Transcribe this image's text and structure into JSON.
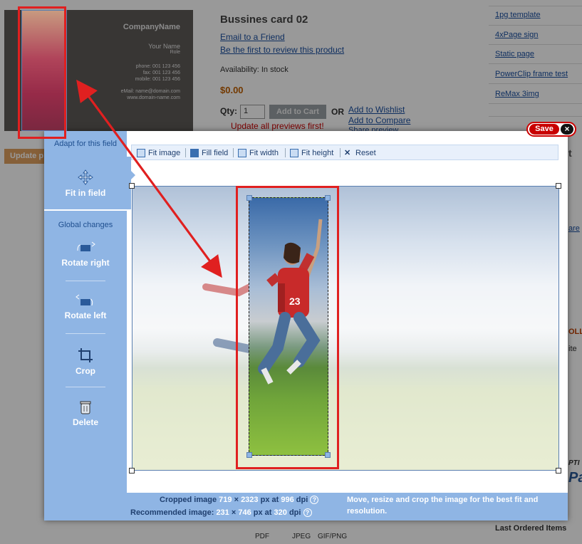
{
  "product": {
    "title": "Bussines card 02",
    "email_friend": "Email to a Friend",
    "review": "Be the first to review this product",
    "availability": "Availability: In stock",
    "price": "$0.00",
    "qty_label": "Qty:",
    "qty_value": "1",
    "add_to_cart": "Add to Cart",
    "or": "OR",
    "wishlist": "Add to Wishlist",
    "compare": "Add to Compare",
    "share": "Share preview",
    "update_warning": "Update all previews first!",
    "update_button": "Update p"
  },
  "card": {
    "company": "CompanyName",
    "name": "Your Name",
    "role": "Role",
    "phone": "phone: 001 123 456",
    "fax": "fax: 001 123 456",
    "mobile": "mobile: 001 123 456",
    "email": "eMail: name@domain.com",
    "web": "www.domain-name.com"
  },
  "sidebar": {
    "links": [
      "1pg template",
      "4xPage sign",
      "Static page",
      "PowerClip frame test",
      "ReMax 3img"
    ],
    "last_ordered": "Last Ordered Items",
    "partial": [
      "t",
      "are",
      "OLL",
      "ite",
      "PTI",
      "Pa"
    ]
  },
  "formats": [
    "PDF",
    "JPEG",
    "GIF/PNG"
  ],
  "dialog": {
    "adapt_label": "Adapt for this field",
    "fit_in_field": "Fit in field",
    "global_label": "Global changes",
    "rotate_right": "Rotate right",
    "rotate_left": "Rotate left",
    "crop": "Crop",
    "delete": "Delete",
    "save": "Save",
    "close": "×",
    "toolbar": {
      "fit_image": "Fit image",
      "fill_field": "Fill field",
      "fit_width": "Fit width",
      "fit_height": "Fit height",
      "reset": "Reset"
    },
    "info": {
      "cropped_label": "Cropped image",
      "cropped_w": "719",
      "cropped_h": "2323",
      "cropped_dpi": "996",
      "recommended_label": "Recommended image:",
      "rec_w": "231",
      "rec_h": "746",
      "rec_dpi": "320",
      "x": "×",
      "px_at": "px at",
      "dpi": "dpi",
      "help": "?",
      "message": "Move, resize and crop the image for the best fit and resolution."
    }
  },
  "colors": {
    "panel_blue": "#8fb5e4",
    "highlight_red": "#e02020",
    "save_red": "#c80000"
  }
}
